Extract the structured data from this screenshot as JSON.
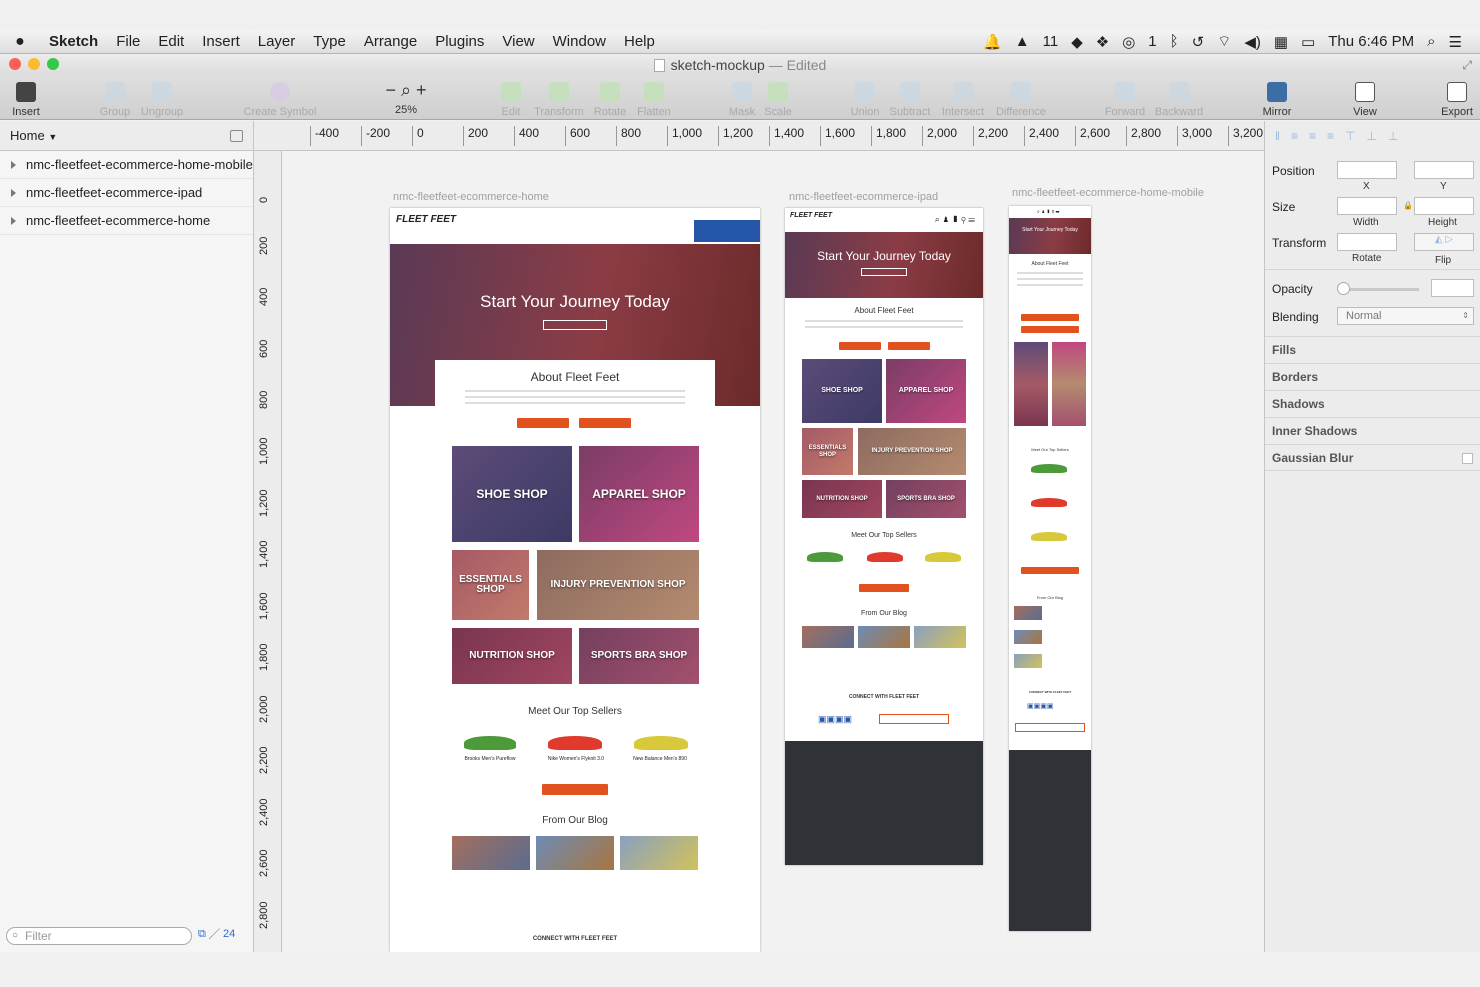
{
  "menubar": {
    "app": "Sketch",
    "items": [
      "File",
      "Edit",
      "Insert",
      "Layer",
      "Type",
      "Arrange",
      "Plugins",
      "View",
      "Window",
      "Help"
    ],
    "badge1": "11",
    "badge2": "1",
    "clock": "Thu 6:46 PM"
  },
  "window": {
    "title": "sketch-mockup",
    "status": "— Edited"
  },
  "toolbar": {
    "insert": "Insert",
    "group": "Group",
    "ungroup": "Ungroup",
    "create_symbol": "Create Symbol",
    "zoom": "25%",
    "edit": "Edit",
    "transform": "Transform",
    "rotate": "Rotate",
    "flatten": "Flatten",
    "mask": "Mask",
    "scale": "Scale",
    "union": "Union",
    "subtract": "Subtract",
    "intersect": "Intersect",
    "difference": "Difference",
    "forward": "Forward",
    "backward": "Backward",
    "mirror": "Mirror",
    "view": "View",
    "export": "Export"
  },
  "pages": {
    "current": "Home"
  },
  "ruler": {
    "h": [
      "-400",
      "-200",
      "0",
      "200",
      "400",
      "600",
      "800",
      "1,000",
      "1,200",
      "1,400",
      "1,600",
      "1,800",
      "2,000",
      "2,200",
      "2,400",
      "2,600",
      "2,800",
      "3,000",
      "3,200"
    ],
    "v": [
      "0",
      "200",
      "400",
      "600",
      "800",
      "1,000",
      "1,200",
      "1,400",
      "1,600",
      "1,800",
      "2,000",
      "2,200",
      "2,400",
      "2,600",
      "2,800"
    ]
  },
  "layers": [
    "nmc-fleetfeet-ecommerce-home-mobile",
    "nmc-fleetfeet-ecommerce-ipad",
    "nmc-fleetfeet-ecommerce-home"
  ],
  "filter": {
    "placeholder": "Filter",
    "count": "24"
  },
  "artboards": {
    "home": {
      "label": "nmc-fleetfeet-ecommerce-home",
      "logo": "FLEET FEET",
      "hero": "Start Your Journey Today",
      "about": "About Fleet Feet",
      "tiles": [
        "SHOE SHOP",
        "APPAREL SHOP",
        "ESSENTIALS SHOP",
        "INJURY PREVENTION SHOP",
        "NUTRITION SHOP",
        "SPORTS BRA SHOP"
      ],
      "sellers": "Meet Our Top Sellers",
      "products": [
        "Brooks Men's Pureflow",
        "Nike Women's Flyknit 3.0",
        "New Balance Men's 890"
      ],
      "blog": "From Our Blog",
      "connect": "CONNECT WITH FLEET FEET"
    },
    "ipad": {
      "label": "nmc-fleetfeet-ecommerce-ipad",
      "logo": "FLEET FEET",
      "hero": "Start Your Journey Today",
      "about": "About Fleet Feet",
      "tiles": [
        "SHOE SHOP",
        "APPAREL SHOP",
        "ESSENTIALS SHOP",
        "INJURY PREVENTION SHOP",
        "NUTRITION SHOP",
        "SPORTS BRA SHOP"
      ],
      "sellers": "Meet Our Top Sellers",
      "blog": "From Our Blog",
      "connect": "CONNECT WITH FLEET FEET"
    },
    "mobile": {
      "label": "nmc-fleetfeet-ecommerce-home-mobile",
      "hero": "Start Your Journey Today",
      "about": "About Fleet Feet",
      "sellers": "Meet Our Top Sellers",
      "blog": "From Our Blog",
      "connect": "CONNECT WITH FLEET FEET"
    }
  },
  "inspector": {
    "position": "Position",
    "x": "X",
    "y": "Y",
    "size": "Size",
    "width": "Width",
    "height": "Height",
    "transform": "Transform",
    "rotate": "Rotate",
    "flip": "Flip",
    "opacity": "Opacity",
    "blending": "Blending",
    "blend_value": "Normal",
    "sections": [
      "Fills",
      "Borders",
      "Shadows",
      "Inner Shadows",
      "Gaussian Blur"
    ]
  },
  "colors": {
    "accent": "#e2521f",
    "footer": "#2f3236"
  }
}
